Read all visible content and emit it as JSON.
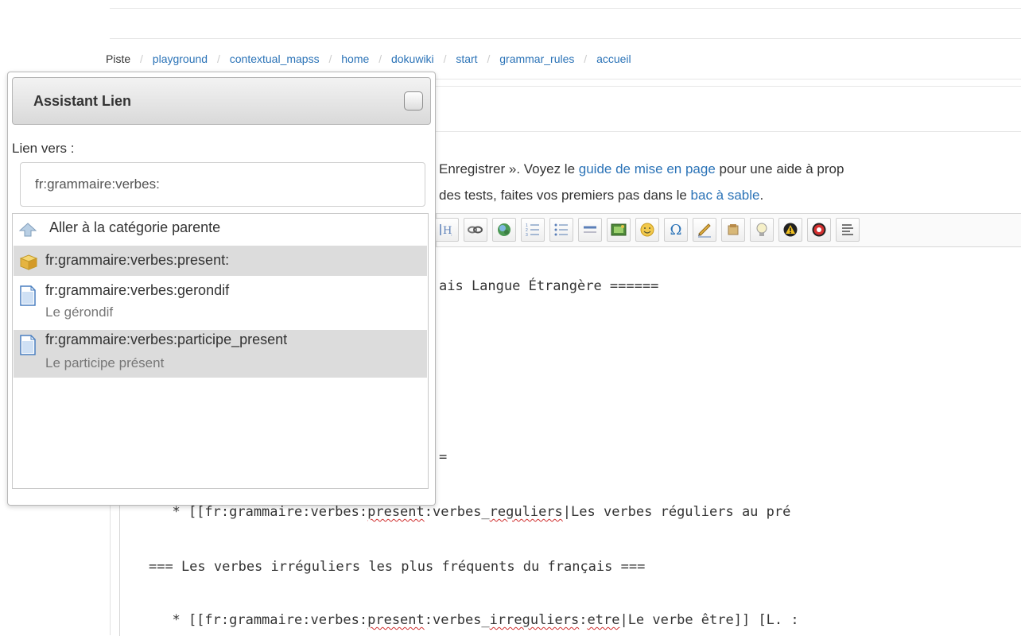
{
  "breadcrumb": {
    "lead": "Piste",
    "items": [
      "playground",
      "contextual_mapss",
      "home",
      "dokuwiki",
      "start",
      "grammar_rules",
      "accueil"
    ]
  },
  "intro": {
    "line1_a": "Enregistrer ». Voyez le ",
    "line1_link": "guide de mise en page",
    "line1_b": " pour une aide à prop",
    "line2_a": "des tests, faites vos premiers pas dans le ",
    "line2_link": "bac à sable",
    "line2_b": "."
  },
  "toolbar": {
    "buttons": [
      "header-icon",
      "link-icon",
      "external-link-icon",
      "ordered-list-icon",
      "unordered-list-icon",
      "horizontal-rule-icon",
      "image-icon",
      "smiley-icon",
      "omega-icon",
      "signature-icon",
      "media-icon",
      "lightbulb-icon",
      "warning-icon",
      "stop-icon",
      "justify-icon"
    ],
    "header_glyph": "H",
    "omega_glyph": "Ω"
  },
  "editor": {
    "line1": "ais Langue Étrangère ======",
    "line2": "=",
    "line3_a": "  * [[fr:grammaire:verbes:",
    "line3_b": "present",
    "line3_c": ":verbes_",
    "line3_d": "reguliers",
    "line3_e": "|Les verbes réguliers au pré",
    "line4": "=== Les verbes irréguliers les plus fréquents du français ===",
    "line5_a": "  * [[fr:grammaire:verbes:",
    "line5_b": "present",
    "line5_c": ":verbes_",
    "line5_d": "irreguliers",
    "line5_e": ":",
    "line5_f": "etre",
    "line5_g": "|Le verbe être]] [L. :"
  },
  "dialog": {
    "title": "Assistant Lien",
    "label": "Lien vers :",
    "input_value": "fr:grammaire:verbes:",
    "items": [
      {
        "label": "Aller à la catégorie parente",
        "icon": "up-arrow-icon"
      },
      {
        "label": "fr:grammaire:verbes:present:",
        "icon": "namespace-box-icon"
      },
      {
        "label": "fr:grammaire:verbes:gerondif",
        "subtitle": "Le gérondif",
        "icon": "page-icon"
      },
      {
        "label": "fr:grammaire:verbes:participe_present",
        "subtitle": "Le participe présent",
        "icon": "page-icon"
      }
    ]
  },
  "colors": {
    "link": "#2b73b7",
    "selection": "#dcdcdc",
    "spellcheck": "#d03030"
  }
}
